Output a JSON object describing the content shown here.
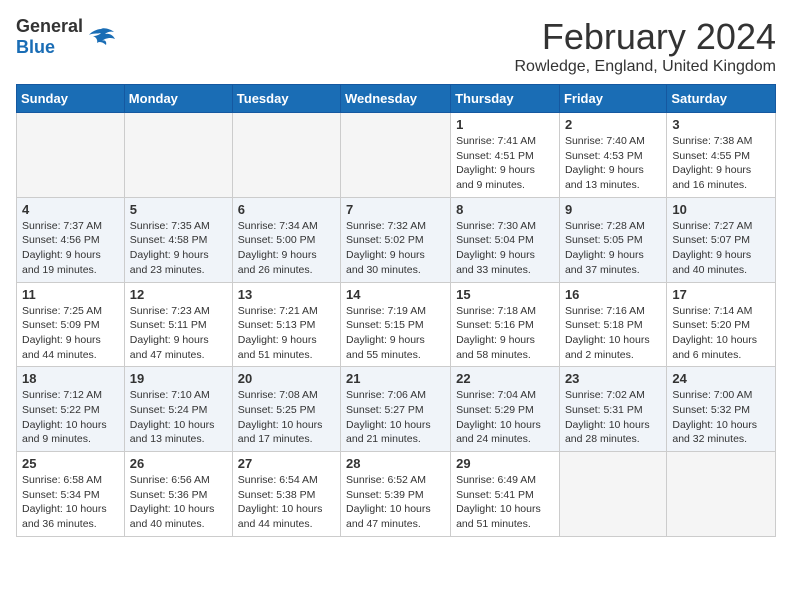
{
  "header": {
    "logo_general": "General",
    "logo_blue": "Blue",
    "month_year": "February 2024",
    "location": "Rowledge, England, United Kingdom"
  },
  "days_of_week": [
    "Sunday",
    "Monday",
    "Tuesday",
    "Wednesday",
    "Thursday",
    "Friday",
    "Saturday"
  ],
  "weeks": [
    [
      {
        "day": "",
        "info": ""
      },
      {
        "day": "",
        "info": ""
      },
      {
        "day": "",
        "info": ""
      },
      {
        "day": "",
        "info": ""
      },
      {
        "day": "1",
        "info": "Sunrise: 7:41 AM\nSunset: 4:51 PM\nDaylight: 9 hours\nand 9 minutes."
      },
      {
        "day": "2",
        "info": "Sunrise: 7:40 AM\nSunset: 4:53 PM\nDaylight: 9 hours\nand 13 minutes."
      },
      {
        "day": "3",
        "info": "Sunrise: 7:38 AM\nSunset: 4:55 PM\nDaylight: 9 hours\nand 16 minutes."
      }
    ],
    [
      {
        "day": "4",
        "info": "Sunrise: 7:37 AM\nSunset: 4:56 PM\nDaylight: 9 hours\nand 19 minutes."
      },
      {
        "day": "5",
        "info": "Sunrise: 7:35 AM\nSunset: 4:58 PM\nDaylight: 9 hours\nand 23 minutes."
      },
      {
        "day": "6",
        "info": "Sunrise: 7:34 AM\nSunset: 5:00 PM\nDaylight: 9 hours\nand 26 minutes."
      },
      {
        "day": "7",
        "info": "Sunrise: 7:32 AM\nSunset: 5:02 PM\nDaylight: 9 hours\nand 30 minutes."
      },
      {
        "day": "8",
        "info": "Sunrise: 7:30 AM\nSunset: 5:04 PM\nDaylight: 9 hours\nand 33 minutes."
      },
      {
        "day": "9",
        "info": "Sunrise: 7:28 AM\nSunset: 5:05 PM\nDaylight: 9 hours\nand 37 minutes."
      },
      {
        "day": "10",
        "info": "Sunrise: 7:27 AM\nSunset: 5:07 PM\nDaylight: 9 hours\nand 40 minutes."
      }
    ],
    [
      {
        "day": "11",
        "info": "Sunrise: 7:25 AM\nSunset: 5:09 PM\nDaylight: 9 hours\nand 44 minutes."
      },
      {
        "day": "12",
        "info": "Sunrise: 7:23 AM\nSunset: 5:11 PM\nDaylight: 9 hours\nand 47 minutes."
      },
      {
        "day": "13",
        "info": "Sunrise: 7:21 AM\nSunset: 5:13 PM\nDaylight: 9 hours\nand 51 minutes."
      },
      {
        "day": "14",
        "info": "Sunrise: 7:19 AM\nSunset: 5:15 PM\nDaylight: 9 hours\nand 55 minutes."
      },
      {
        "day": "15",
        "info": "Sunrise: 7:18 AM\nSunset: 5:16 PM\nDaylight: 9 hours\nand 58 minutes."
      },
      {
        "day": "16",
        "info": "Sunrise: 7:16 AM\nSunset: 5:18 PM\nDaylight: 10 hours\nand 2 minutes."
      },
      {
        "day": "17",
        "info": "Sunrise: 7:14 AM\nSunset: 5:20 PM\nDaylight: 10 hours\nand 6 minutes."
      }
    ],
    [
      {
        "day": "18",
        "info": "Sunrise: 7:12 AM\nSunset: 5:22 PM\nDaylight: 10 hours\nand 9 minutes."
      },
      {
        "day": "19",
        "info": "Sunrise: 7:10 AM\nSunset: 5:24 PM\nDaylight: 10 hours\nand 13 minutes."
      },
      {
        "day": "20",
        "info": "Sunrise: 7:08 AM\nSunset: 5:25 PM\nDaylight: 10 hours\nand 17 minutes."
      },
      {
        "day": "21",
        "info": "Sunrise: 7:06 AM\nSunset: 5:27 PM\nDaylight: 10 hours\nand 21 minutes."
      },
      {
        "day": "22",
        "info": "Sunrise: 7:04 AM\nSunset: 5:29 PM\nDaylight: 10 hours\nand 24 minutes."
      },
      {
        "day": "23",
        "info": "Sunrise: 7:02 AM\nSunset: 5:31 PM\nDaylight: 10 hours\nand 28 minutes."
      },
      {
        "day": "24",
        "info": "Sunrise: 7:00 AM\nSunset: 5:32 PM\nDaylight: 10 hours\nand 32 minutes."
      }
    ],
    [
      {
        "day": "25",
        "info": "Sunrise: 6:58 AM\nSunset: 5:34 PM\nDaylight: 10 hours\nand 36 minutes."
      },
      {
        "day": "26",
        "info": "Sunrise: 6:56 AM\nSunset: 5:36 PM\nDaylight: 10 hours\nand 40 minutes."
      },
      {
        "day": "27",
        "info": "Sunrise: 6:54 AM\nSunset: 5:38 PM\nDaylight: 10 hours\nand 44 minutes."
      },
      {
        "day": "28",
        "info": "Sunrise: 6:52 AM\nSunset: 5:39 PM\nDaylight: 10 hours\nand 47 minutes."
      },
      {
        "day": "29",
        "info": "Sunrise: 6:49 AM\nSunset: 5:41 PM\nDaylight: 10 hours\nand 51 minutes."
      },
      {
        "day": "",
        "info": ""
      },
      {
        "day": "",
        "info": ""
      }
    ]
  ]
}
